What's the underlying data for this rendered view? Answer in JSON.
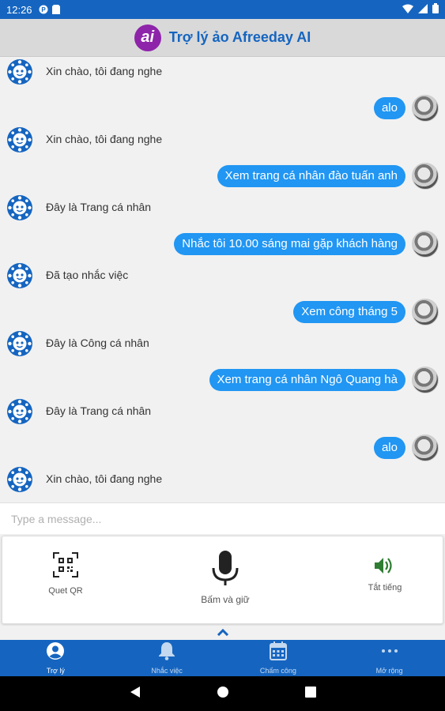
{
  "status_bar": {
    "time": "12:26"
  },
  "header": {
    "logo_text": "ai",
    "title": "Trợ lý ảo Afreeday AI"
  },
  "messages": [
    {
      "from": "bot",
      "text": "Xin chào, tôi đang nghe"
    },
    {
      "from": "user",
      "text": "alo"
    },
    {
      "from": "bot",
      "text": "Xin chào, tôi đang nghe"
    },
    {
      "from": "user",
      "text": "Xem trang cá nhân đào tuấn anh"
    },
    {
      "from": "bot",
      "text": "Đây là Trang cá nhân"
    },
    {
      "from": "user",
      "text": "Nhắc tôi 10.00 sáng mai gặp khách hàng"
    },
    {
      "from": "bot",
      "text": "Đã tạo nhắc việc"
    },
    {
      "from": "user",
      "text": "Xem công tháng 5"
    },
    {
      "from": "bot",
      "text": "Đây là Công cá nhân"
    },
    {
      "from": "user",
      "text": "Xem trang cá nhân Ngô Quang hà"
    },
    {
      "from": "bot",
      "text": "Đây là Trang cá nhân"
    },
    {
      "from": "user",
      "text": "alo"
    },
    {
      "from": "bot",
      "text": "Xin chào, tôi đang nghe"
    }
  ],
  "input": {
    "placeholder": "Type a message..."
  },
  "controls": {
    "qr_label": "Quet QR",
    "mic_label": "Bấm và giữ",
    "mute_label": "Tắt tiếng"
  },
  "bottom_nav": [
    {
      "label": "Trợ lý",
      "icon": "person-icon",
      "active": true
    },
    {
      "label": "Nhắc việc",
      "icon": "bell-icon",
      "active": false
    },
    {
      "label": "Chấm công",
      "icon": "calendar-icon",
      "active": false
    },
    {
      "label": "Mở rộng",
      "icon": "more-icon",
      "active": false
    }
  ],
  "colors": {
    "primary": "#1565c0",
    "bubble": "#2196f3",
    "logo": "#8e24aa",
    "speaker": "#2e7d32"
  }
}
